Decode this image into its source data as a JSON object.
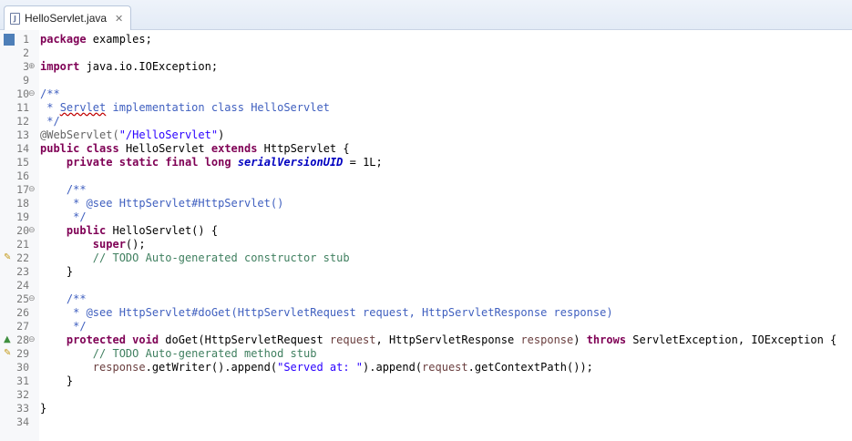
{
  "tab": {
    "title": "HelloServlet.java",
    "close": "✕"
  },
  "lines": [
    {
      "n": "1",
      "fold": "",
      "marker": "bookmark",
      "tokens": [
        {
          "t": "package",
          "c": "kw"
        },
        {
          "t": " examples;",
          "c": "tx"
        }
      ]
    },
    {
      "n": "2",
      "fold": "",
      "marker": "",
      "tokens": []
    },
    {
      "n": "3",
      "fold": "⊕",
      "marker": "",
      "tokens": [
        {
          "t": "import",
          "c": "kw"
        },
        {
          "t": " java.io.IOException;",
          "c": "tx"
        }
      ]
    },
    {
      "n": "9",
      "fold": "",
      "marker": "",
      "tokens": []
    },
    {
      "n": "10",
      "fold": "⊖",
      "marker": "",
      "tokens": [
        {
          "t": "/**",
          "c": "cm"
        }
      ]
    },
    {
      "n": "11",
      "fold": "",
      "marker": "",
      "tokens": [
        {
          "t": " * ",
          "c": "cm"
        },
        {
          "t": "Servlet",
          "c": "cm sq"
        },
        {
          "t": " implementation class HelloServlet",
          "c": "cm"
        }
      ]
    },
    {
      "n": "12",
      "fold": "",
      "marker": "",
      "tokens": [
        {
          "t": " */",
          "c": "cm"
        }
      ]
    },
    {
      "n": "13",
      "fold": "",
      "marker": "",
      "tokens": [
        {
          "t": "@WebServlet(",
          "c": "an"
        },
        {
          "t": "\"/HelloServlet\"",
          "c": "st"
        },
        {
          "t": ")",
          "c": "tx"
        }
      ]
    },
    {
      "n": "14",
      "fold": "",
      "marker": "",
      "tokens": [
        {
          "t": "public",
          "c": "kw"
        },
        {
          "t": " ",
          "c": "tx"
        },
        {
          "t": "class",
          "c": "kw"
        },
        {
          "t": " HelloServlet ",
          "c": "tx"
        },
        {
          "t": "extends",
          "c": "kw"
        },
        {
          "t": " HttpServlet {",
          "c": "tx"
        }
      ]
    },
    {
      "n": "15",
      "fold": "",
      "marker": "",
      "tokens": [
        {
          "t": "    ",
          "c": "tx"
        },
        {
          "t": "private",
          "c": "kw"
        },
        {
          "t": " ",
          "c": "tx"
        },
        {
          "t": "static",
          "c": "kw"
        },
        {
          "t": " ",
          "c": "tx"
        },
        {
          "t": "final",
          "c": "kw"
        },
        {
          "t": " ",
          "c": "tx"
        },
        {
          "t": "long",
          "c": "kw"
        },
        {
          "t": " ",
          "c": "tx"
        },
        {
          "t": "serialVersionUID",
          "c": "fd"
        },
        {
          "t": " = 1L;",
          "c": "tx"
        }
      ]
    },
    {
      "n": "16",
      "fold": "",
      "marker": "",
      "tokens": []
    },
    {
      "n": "17",
      "fold": "⊖",
      "marker": "",
      "tokens": [
        {
          "t": "    /**",
          "c": "cm"
        }
      ]
    },
    {
      "n": "18",
      "fold": "",
      "marker": "",
      "tokens": [
        {
          "t": "     * @see HttpServlet#HttpServlet()",
          "c": "cm"
        }
      ]
    },
    {
      "n": "19",
      "fold": "",
      "marker": "",
      "tokens": [
        {
          "t": "     */",
          "c": "cm"
        }
      ]
    },
    {
      "n": "20",
      "fold": "⊖",
      "marker": "",
      "tokens": [
        {
          "t": "    ",
          "c": "tx"
        },
        {
          "t": "public",
          "c": "kw"
        },
        {
          "t": " HelloServlet() {",
          "c": "tx"
        }
      ]
    },
    {
      "n": "21",
      "fold": "",
      "marker": "",
      "tokens": [
        {
          "t": "        ",
          "c": "tx"
        },
        {
          "t": "super",
          "c": "kw"
        },
        {
          "t": "();",
          "c": "tx"
        }
      ]
    },
    {
      "n": "22",
      "fold": "",
      "marker": "task",
      "tokens": [
        {
          "t": "        // TODO Auto-generated constructor stub",
          "c": "ln"
        }
      ]
    },
    {
      "n": "23",
      "fold": "",
      "marker": "",
      "tokens": [
        {
          "t": "    }",
          "c": "tx"
        }
      ]
    },
    {
      "n": "24",
      "fold": "",
      "marker": "",
      "tokens": []
    },
    {
      "n": "25",
      "fold": "⊖",
      "marker": "",
      "tokens": [
        {
          "t": "    /**",
          "c": "cm"
        }
      ]
    },
    {
      "n": "26",
      "fold": "",
      "marker": "",
      "tokens": [
        {
          "t": "     * @see HttpServlet#doGet(HttpServletRequest request, HttpServletResponse response)",
          "c": "cm"
        }
      ]
    },
    {
      "n": "27",
      "fold": "",
      "marker": "",
      "tokens": [
        {
          "t": "     */",
          "c": "cm"
        }
      ]
    },
    {
      "n": "28",
      "fold": "⊖",
      "marker": "override",
      "tokens": [
        {
          "t": "    ",
          "c": "tx"
        },
        {
          "t": "protected",
          "c": "kw"
        },
        {
          "t": " ",
          "c": "tx"
        },
        {
          "t": "void",
          "c": "kw"
        },
        {
          "t": " doGet(HttpServletRequest ",
          "c": "tx"
        },
        {
          "t": "request",
          "c": "pr"
        },
        {
          "t": ", HttpServletResponse ",
          "c": "tx"
        },
        {
          "t": "response",
          "c": "pr"
        },
        {
          "t": ") ",
          "c": "tx"
        },
        {
          "t": "throws",
          "c": "kw"
        },
        {
          "t": " ServletException, IOException {",
          "c": "tx"
        }
      ]
    },
    {
      "n": "29",
      "fold": "",
      "marker": "task",
      "tokens": [
        {
          "t": "        // TODO Auto-generated method stub",
          "c": "ln"
        }
      ]
    },
    {
      "n": "30",
      "fold": "",
      "marker": "",
      "tokens": [
        {
          "t": "        ",
          "c": "tx"
        },
        {
          "t": "response",
          "c": "pr"
        },
        {
          "t": ".getWriter().append(",
          "c": "tx"
        },
        {
          "t": "\"Served at: \"",
          "c": "st"
        },
        {
          "t": ").append(",
          "c": "tx"
        },
        {
          "t": "request",
          "c": "pr"
        },
        {
          "t": ".getContextPath());",
          "c": "tx"
        }
      ]
    },
    {
      "n": "31",
      "fold": "",
      "marker": "",
      "tokens": [
        {
          "t": "    }",
          "c": "tx"
        }
      ]
    },
    {
      "n": "32",
      "fold": "",
      "marker": "",
      "tokens": []
    },
    {
      "n": "33",
      "fold": "",
      "marker": "",
      "tokens": [
        {
          "t": "}",
          "c": "tx"
        }
      ]
    },
    {
      "n": "34",
      "fold": "",
      "marker": "",
      "tokens": []
    }
  ]
}
